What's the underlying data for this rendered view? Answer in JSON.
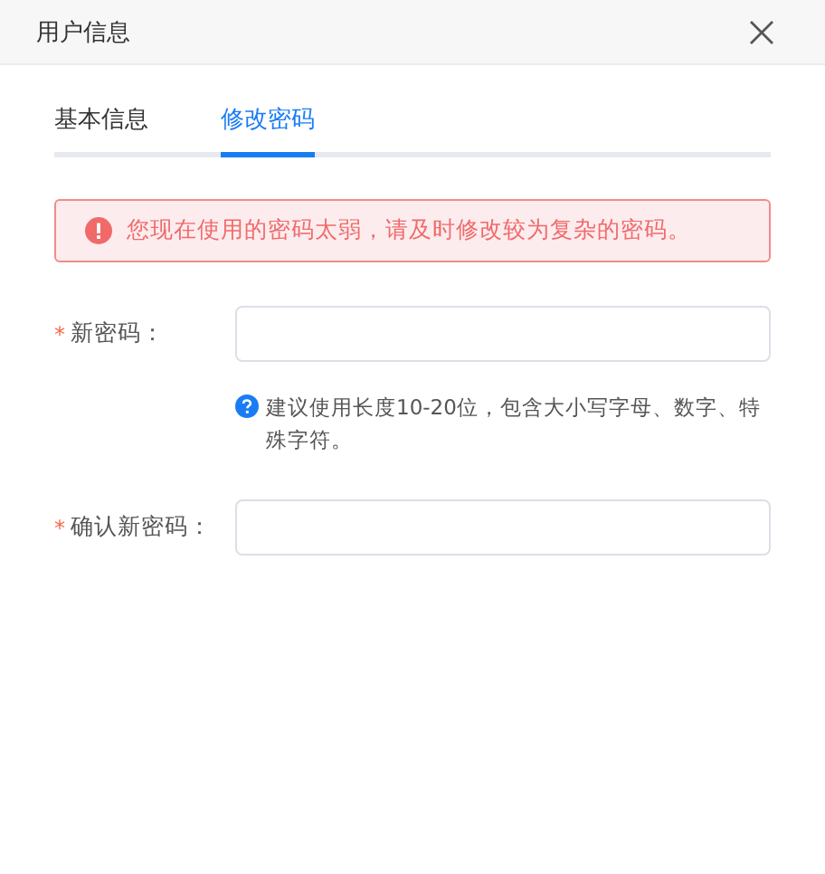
{
  "window": {
    "title": "用户信息"
  },
  "tabs": [
    {
      "label": "基本信息",
      "selected": false
    },
    {
      "label": "修改密码",
      "selected": true
    }
  ],
  "alert": {
    "text": "您现在使用的密码太弱，请及时修改较为复杂的密码。"
  },
  "fields": [
    {
      "required_mark": "*",
      "label": "新密码：",
      "hint": "建议使用长度10-20位，包含大小写字母、数字、特殊字符。"
    },
    {
      "required_mark": "*",
      "label": "确认新密码："
    }
  ]
}
